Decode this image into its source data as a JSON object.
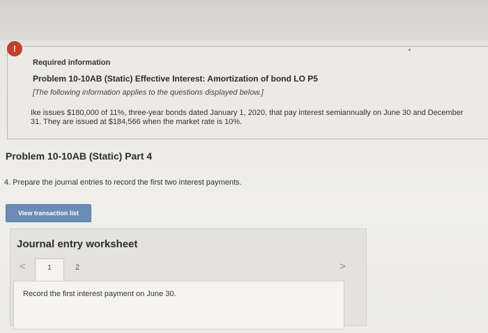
{
  "alert": {
    "symbol": "!"
  },
  "info": {
    "heading": "Required information",
    "problem_title": "Problem 10-10AB (Static) Effective Interest: Amortization of bond LO P5",
    "note": "[The following information applies to the questions displayed below.]",
    "description": "Ike issues $180,000 of 11%, three-year bonds dated January 1, 2020, that pay interest semiannually on June 30 and December 31. They are issued at $184,566 when the market rate is 10%."
  },
  "part": {
    "title": "Problem 10-10AB (Static) Part 4"
  },
  "question": {
    "text": "4. Prepare the journal entries to record the first two interest payments."
  },
  "buttons": {
    "view_transaction_list": "View transaction list"
  },
  "worksheet": {
    "title": "Journal entry worksheet",
    "prev_arrow": "<",
    "next_arrow": ">",
    "tabs": [
      {
        "label": "1"
      },
      {
        "label": "2"
      }
    ],
    "instruction": "Record the first interest payment on June 30."
  },
  "colors": {
    "alert": "#c0402e",
    "button": "#6a8cb5"
  }
}
